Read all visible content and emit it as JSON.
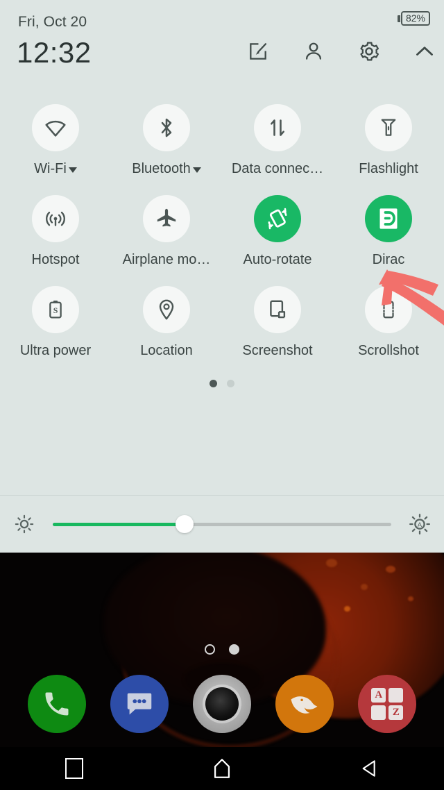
{
  "status": {
    "date": "Fri, Oct 20",
    "time": "12:32",
    "battery_percent": "82%"
  },
  "header_actions": [
    {
      "name": "edit-icon",
      "label": "Edit"
    },
    {
      "name": "user-icon",
      "label": "User"
    },
    {
      "name": "settings-gear-icon",
      "label": "Settings"
    },
    {
      "name": "collapse-chevron-icon",
      "label": "Collapse"
    }
  ],
  "quick_settings": {
    "rows": [
      [
        {
          "label": "Wi-Fi",
          "icon": "wifi-icon",
          "active": false,
          "has_caret": true
        },
        {
          "label": "Bluetooth",
          "icon": "bluetooth-icon",
          "active": false,
          "has_caret": true
        },
        {
          "label": "Data connec…",
          "icon": "data-connection-icon",
          "active": false,
          "has_caret": false
        },
        {
          "label": "Flashlight",
          "icon": "flashlight-icon",
          "active": false,
          "has_caret": false
        }
      ],
      [
        {
          "label": "Hotspot",
          "icon": "hotspot-icon",
          "active": false,
          "has_caret": false
        },
        {
          "label": "Airplane mo…",
          "icon": "airplane-icon",
          "active": false,
          "has_caret": false
        },
        {
          "label": "Auto-rotate",
          "icon": "auto-rotate-icon",
          "active": true,
          "has_caret": false
        },
        {
          "label": "Dirac",
          "icon": "dirac-icon",
          "active": true,
          "has_caret": false
        }
      ],
      [
        {
          "label": "Ultra power",
          "icon": "ultra-power-icon",
          "active": false,
          "has_caret": false
        },
        {
          "label": "Location",
          "icon": "location-pin-icon",
          "active": false,
          "has_caret": false
        },
        {
          "label": "Screenshot",
          "icon": "screenshot-icon",
          "active": false,
          "has_caret": false
        },
        {
          "label": "Scrollshot",
          "icon": "scrollshot-icon",
          "active": false,
          "has_caret": false
        }
      ]
    ],
    "page_dots": {
      "count": 2,
      "active_index": 0
    }
  },
  "brightness": {
    "low_icon": "brightness-low-icon",
    "auto_icon": "brightness-auto-icon",
    "value_percent": 39
  },
  "annotation": {
    "type": "arrow",
    "color": "#f2706b",
    "points_to": "Dirac"
  },
  "dock": [
    {
      "name": "phone-app-icon",
      "label": "Phone",
      "color": "#0e8a12"
    },
    {
      "name": "messages-app-icon",
      "label": "Messages",
      "color": "#2d4da8"
    },
    {
      "name": "camera-app-icon",
      "label": "Camera",
      "color": "#a9a9a9"
    },
    {
      "name": "browser-app-icon",
      "label": "Browser",
      "color": "#d2760c"
    },
    {
      "name": "app-drawer-icon",
      "label": "App drawer",
      "color": "#b5383c",
      "letters": [
        "A",
        "",
        "",
        "Z"
      ]
    }
  ],
  "home_page_dots": {
    "count": 2,
    "active_index": 1
  },
  "navbar": [
    {
      "name": "recents-button",
      "label": "Recents"
    },
    {
      "name": "home-button",
      "label": "Home"
    },
    {
      "name": "back-button",
      "label": "Back"
    }
  ],
  "colors": {
    "panel_bg": "#dde5e3",
    "tile_bg": "#f5f7f6",
    "tile_active": "#19b865",
    "text": "#3b4544",
    "slider_fill": "#18b85f",
    "annotation": "#f2706b"
  }
}
